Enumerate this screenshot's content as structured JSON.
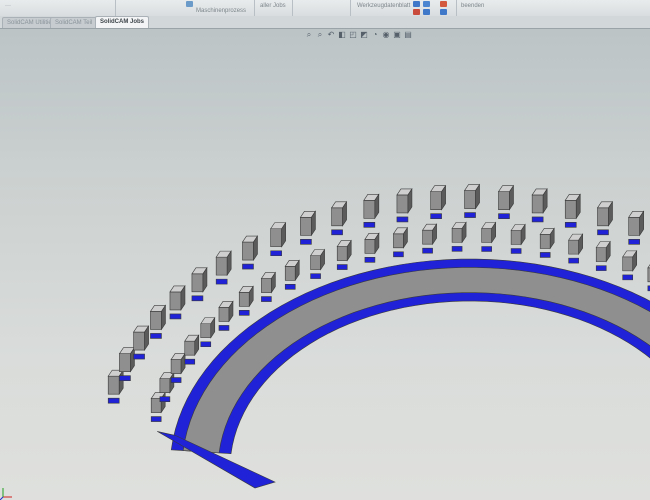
{
  "ribbon": {
    "items": [
      "Maschinenprozess",
      "aller Jobs",
      "Werkzeugdatenblatt",
      "beenden"
    ]
  },
  "tabs": [
    {
      "label": "SolidCAM Utilities"
    },
    {
      "label": "SolidCAM Teil"
    },
    {
      "label": "SolidCAM Jobs"
    }
  ],
  "view": {
    "heads_up_icons": [
      "zoom-fit-icon",
      "zoom-area-icon",
      "previous-view-icon",
      "section-view-icon",
      "view-orientation-icon",
      "display-style-icon",
      "hide-show-icon",
      "appearance-icon",
      "scene-icon",
      "display-pane-icon"
    ],
    "colors": {
      "part_top": "#cfcfcf",
      "part_side": "#8f8f8f",
      "part_shadow": "#5b5b5b",
      "selected_face": "#1f22d6",
      "background_top": "#bcc4c6",
      "background_bottom": "#dfe0dd"
    }
  }
}
